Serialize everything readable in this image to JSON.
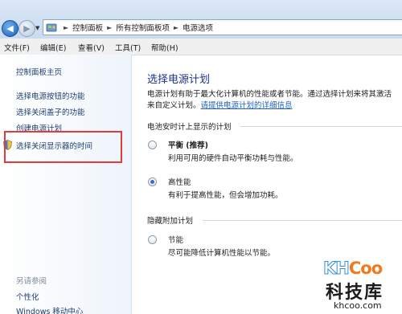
{
  "breadcrumb": [
    "控制面板",
    "所有控制面板项",
    "电源选项"
  ],
  "menu": [
    "文件(F)",
    "编辑(E)",
    "查看(V)",
    "工具(T)",
    "帮助(H)"
  ],
  "sidebar": {
    "home": "控制面板主页",
    "links": [
      "选择电源按钮的功能",
      "选择关闭盖子的功能",
      "创建电源计划",
      "选择关闭显示器的时间"
    ],
    "see_also": "另请参阅",
    "see_also_links": [
      "个性化",
      "Windows 移动中心"
    ]
  },
  "main": {
    "title": "选择电源计划",
    "desc_line1": "电源计划有助于最大化计算机的性能或者节能。通过选择计划来将其激活",
    "desc_line2_prefix": "来自定义计划。",
    "desc_link": "请提供电源计划的详细信息",
    "group1": "电池安时计上显示的计划",
    "group2": "隐藏附加计划",
    "plans": [
      {
        "name": "平衡 (推荐)",
        "desc": "利用可用的硬件自动平衡功耗与性能。",
        "selected": false,
        "bold": true
      },
      {
        "name": "高性能",
        "desc": "有利于提高性能，但会增加功耗。",
        "selected": true,
        "bold": false
      },
      {
        "name": "节能",
        "desc": "尽可能降低计算机性能以节能。",
        "selected": false,
        "bold": false
      }
    ]
  },
  "watermark": {
    "badge_left": "KH",
    "badge_right": "Coo",
    "name": "科技库",
    "url": "khcoo.com"
  },
  "colors": {
    "title": "#1e3287",
    "link": "#1e3f72",
    "highlight_border": "#e33b3b",
    "radio_selected": "#3a6fcf"
  }
}
